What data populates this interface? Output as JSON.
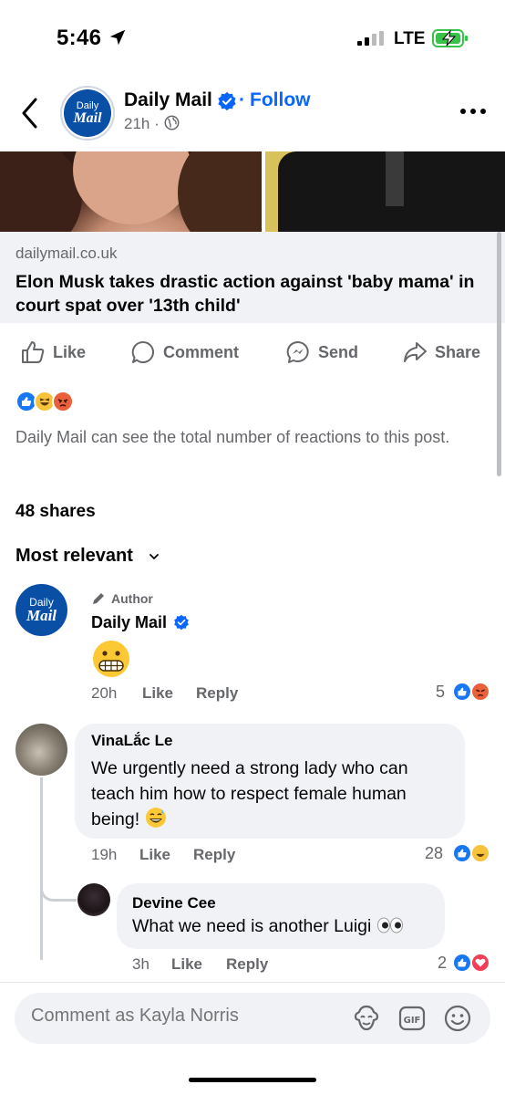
{
  "status_bar": {
    "time": "5:46",
    "network": "LTE"
  },
  "header": {
    "page_name": "Daily Mail",
    "follow_label": "Follow",
    "separator": "·",
    "post_age": "21h ·",
    "avatar_text_top": "Daily",
    "avatar_text_bottom": "Mail"
  },
  "link_preview": {
    "domain": "dailymail.co.uk",
    "title": "Elon Musk takes drastic action against 'baby mama' in court spat over '13th child'"
  },
  "actions": {
    "like": "Like",
    "comment": "Comment",
    "send": "Send",
    "share": "Share"
  },
  "reactions": {
    "types": [
      "like",
      "haha",
      "angry"
    ],
    "privacy_note": "Daily Mail can see the total number of reactions to this post."
  },
  "shares": "48 shares",
  "sort_label": "Most relevant",
  "comments": [
    {
      "badge": "Author",
      "name": "Daily Mail",
      "verified": true,
      "text": "😬",
      "time": "20h",
      "like": "Like",
      "reply": "Reply",
      "reaction_count": "5",
      "reaction_types": [
        "like",
        "angry"
      ]
    },
    {
      "name": "VinaLắc Le",
      "text": "We urgently need a strong lady  who can teach him how to respect female human being!",
      "emoji": "sweat-smile",
      "time": "19h",
      "like": "Like",
      "reply": "Reply",
      "reaction_count": "28",
      "reaction_types": [
        "like",
        "haha"
      ]
    },
    {
      "name": "Devine Cee",
      "text": "What we need is another Luigi",
      "emoji": "eyes",
      "time": "3h",
      "like": "Like",
      "reply": "Reply",
      "reaction_count": "2",
      "reaction_types": [
        "like",
        "love"
      ]
    }
  ],
  "composer": {
    "placeholder": "Comment as Kayla Norris"
  },
  "icons": {
    "back": "chevron-left-icon",
    "more": "more-horizontal-icon",
    "globe": "globe-icon",
    "like": "thumbs-up-icon",
    "comment": "speech-bubble-icon",
    "send": "messenger-icon",
    "share": "share-arrow-icon",
    "avatar_sticker": "avatar-sticker-icon",
    "gif": "gif-icon",
    "emoji": "smiley-icon"
  },
  "colors": {
    "accent": "#0866ff",
    "secondary_text": "#65676b",
    "bubble": "#f0f2f5",
    "brand": "#0a4fa6"
  }
}
